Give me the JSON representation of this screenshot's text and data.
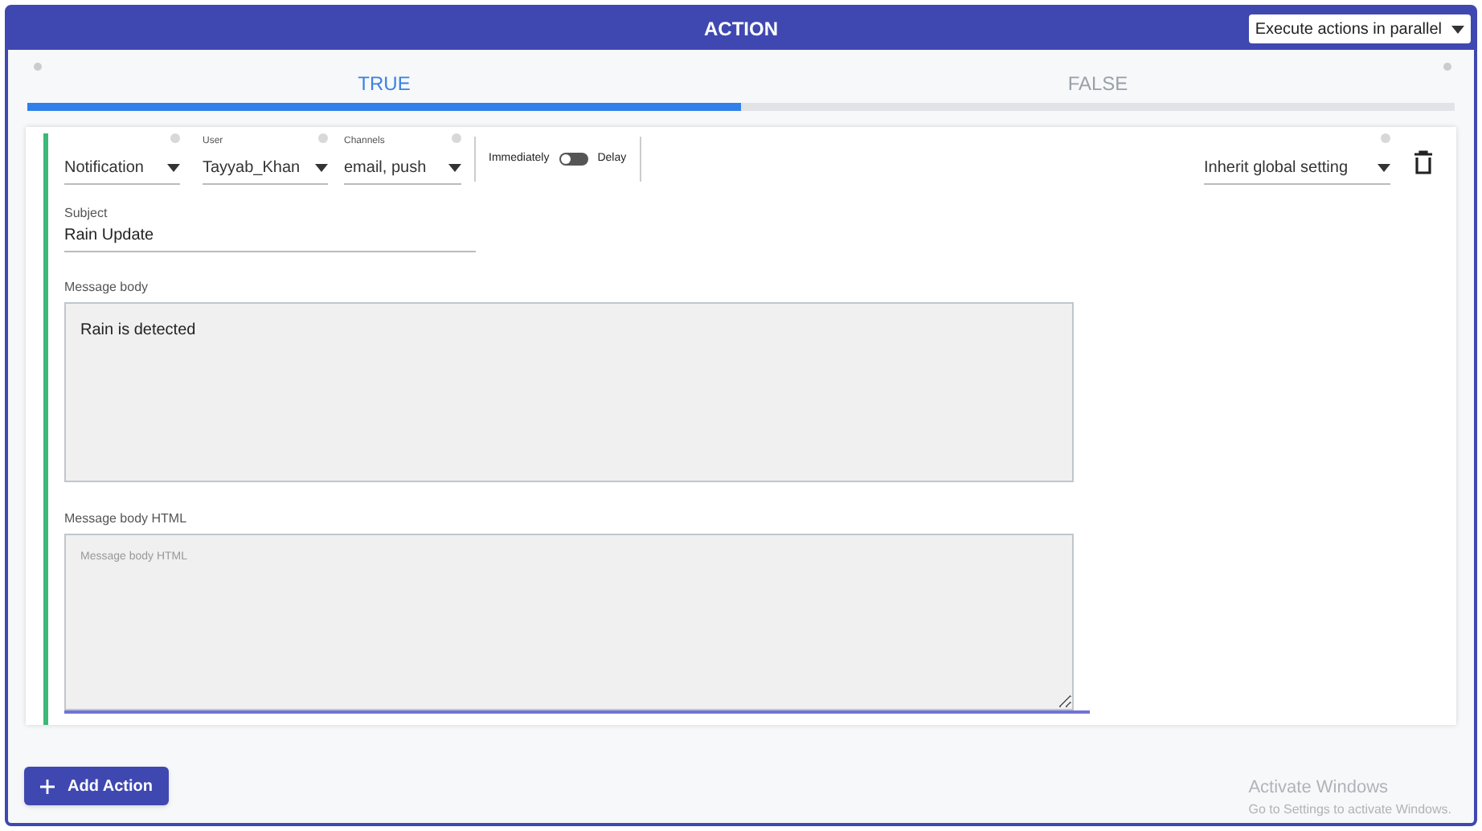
{
  "header": {
    "title": "ACTION",
    "mode_select": {
      "value": "Execute actions in parallel"
    }
  },
  "tabs": [
    {
      "label": "TRUE",
      "selected": true
    },
    {
      "label": "FALSE",
      "selected": false
    }
  ],
  "action": {
    "selects": [
      {
        "value": "Notification"
      },
      {
        "label": "User",
        "value": "Tayyab_Khan"
      },
      {
        "label": "Channels",
        "value": "email, push"
      }
    ],
    "timing": {
      "left": "Immediately",
      "right": "Delay",
      "on": false
    },
    "setting_select": {
      "value": "Inherit global setting"
    },
    "subject": {
      "label": "Subject",
      "value": "Rain Update"
    },
    "body": {
      "label": "Message body",
      "value": "Rain is detected"
    },
    "body_html": {
      "label": "Message body HTML",
      "placeholder": "Message body HTML"
    }
  },
  "add_button": "Add Action",
  "os_overlay": {
    "title": "Activate Windows",
    "subtitle": "Go to Settings to activate Windows."
  }
}
